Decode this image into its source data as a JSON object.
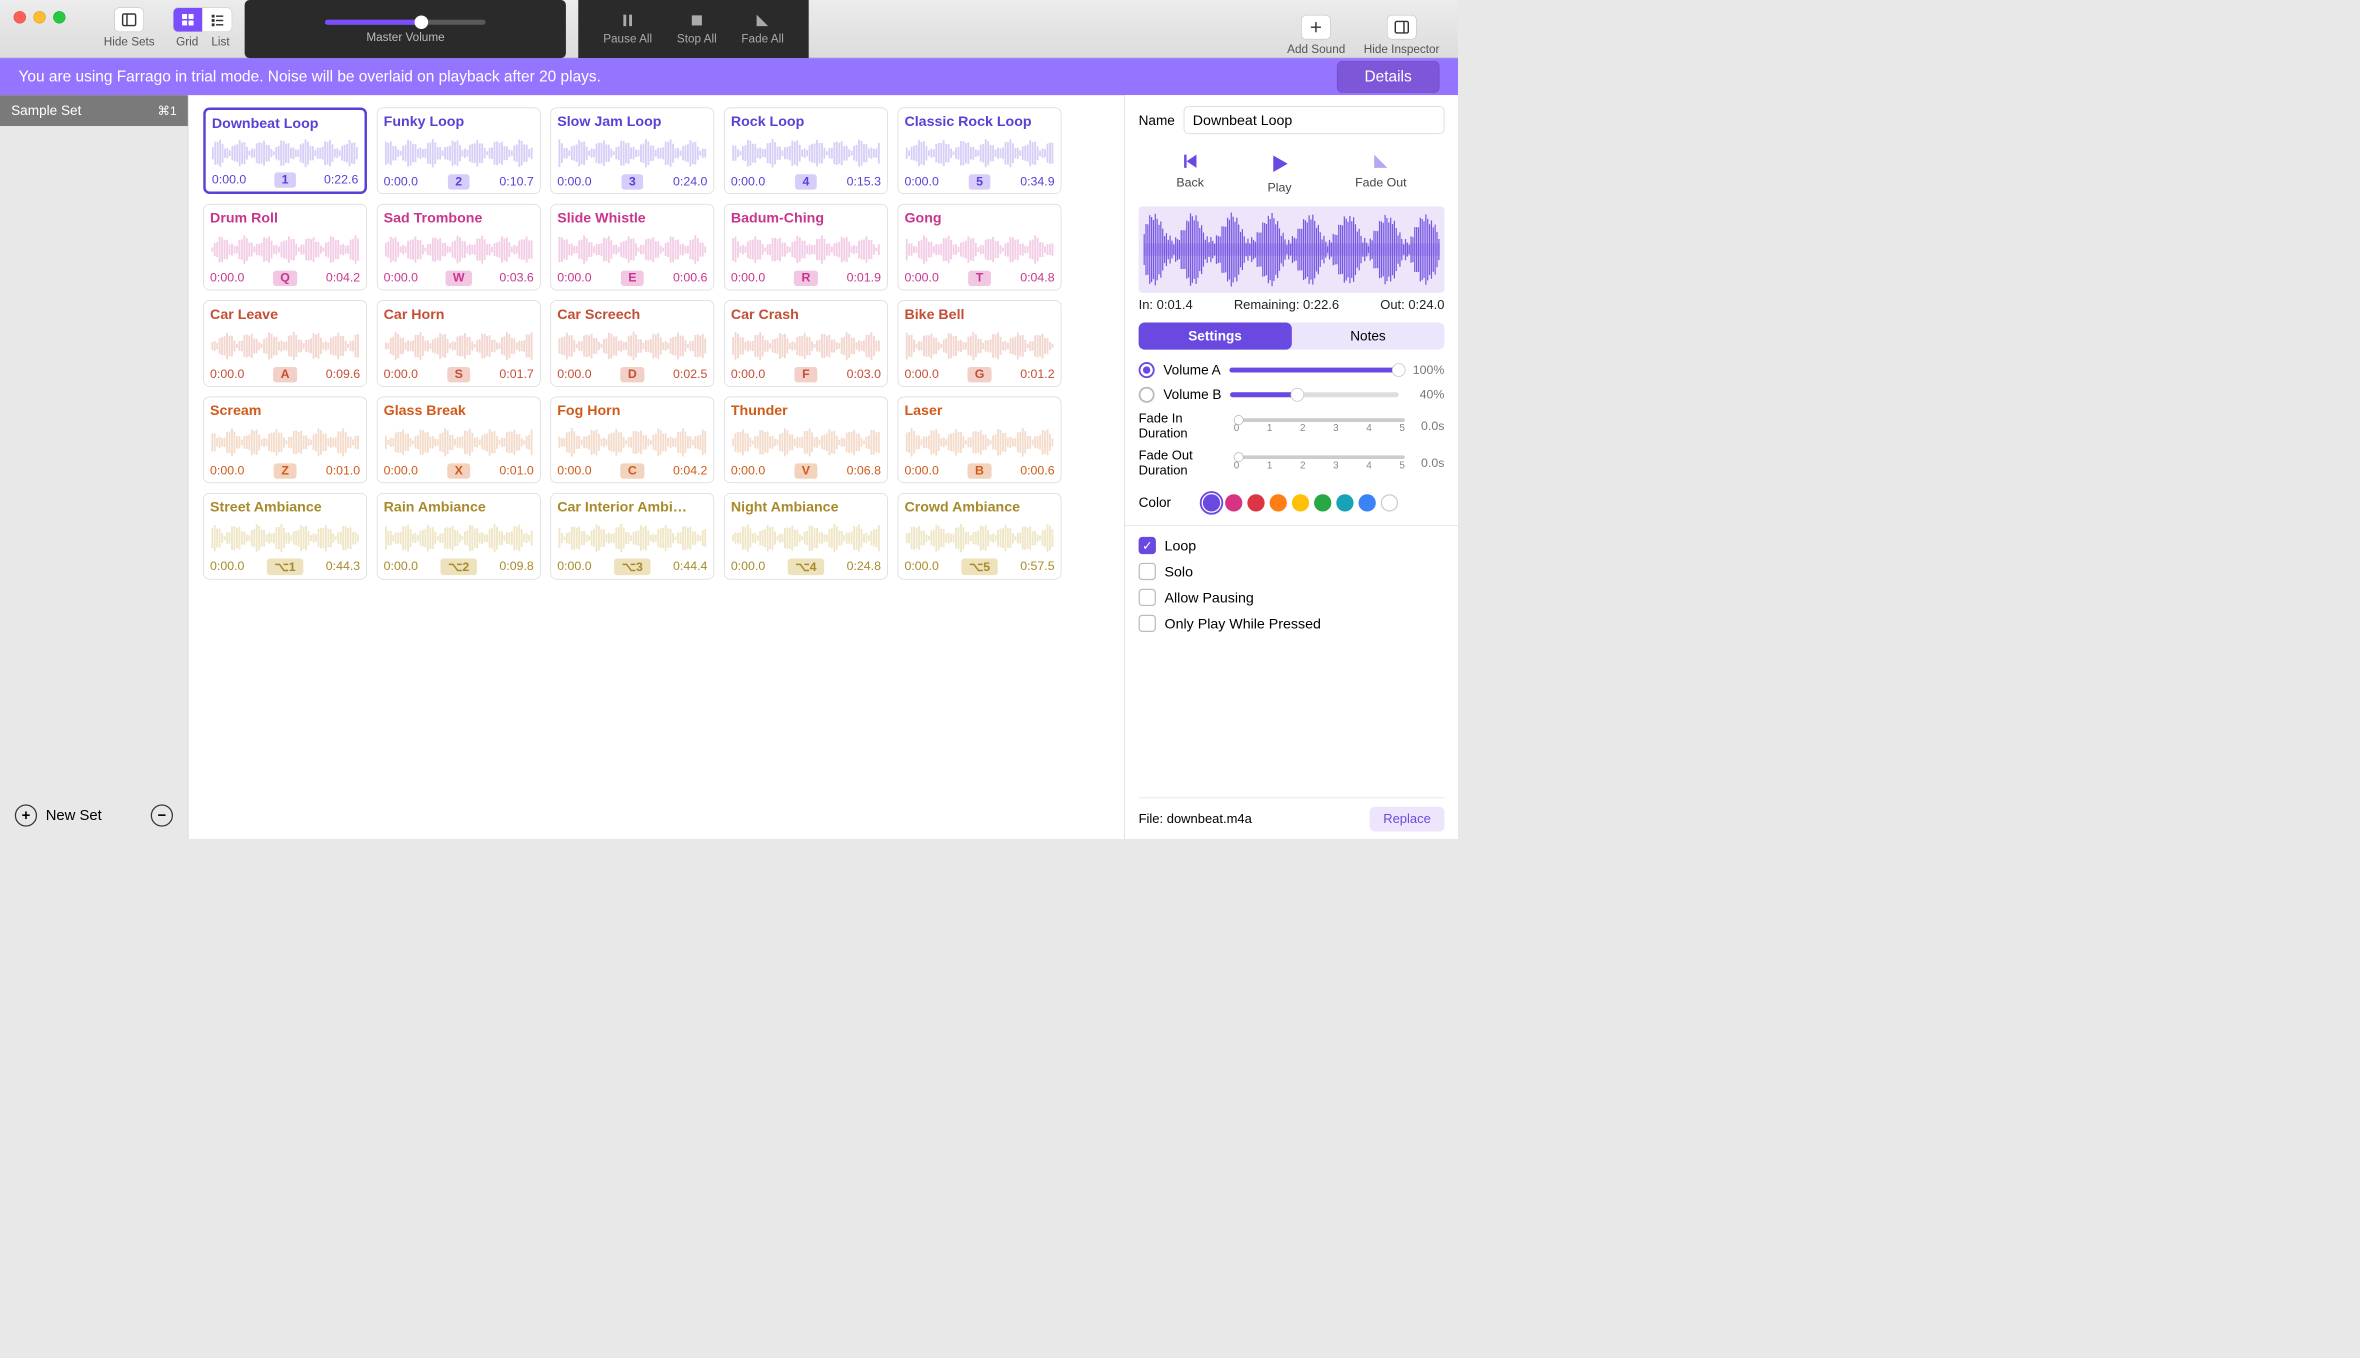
{
  "toolbar": {
    "hide_sets": "Hide Sets",
    "grid": "Grid",
    "list": "List",
    "master_volume": "Master Volume",
    "pause_all": "Pause All",
    "stop_all": "Stop All",
    "fade_all": "Fade All",
    "add_sound": "Add Sound",
    "hide_inspector": "Hide Inspector"
  },
  "banner": {
    "text": "You are using Farrago in trial mode. Noise will be overlaid on playback after 20 plays.",
    "button": "Details"
  },
  "sidebar": {
    "sets": [
      {
        "name": "Sample Set",
        "shortcut": "⌘1"
      }
    ],
    "new_set": "New Set"
  },
  "tiles": [
    {
      "title": "Downbeat Loop",
      "pos": "0:00.0",
      "key": "1",
      "dur": "0:22.6",
      "row": 0,
      "selected": true
    },
    {
      "title": "Funky Loop",
      "pos": "0:00.0",
      "key": "2",
      "dur": "0:10.7",
      "row": 0
    },
    {
      "title": "Slow Jam Loop",
      "pos": "0:00.0",
      "key": "3",
      "dur": "0:24.0",
      "row": 0
    },
    {
      "title": "Rock Loop",
      "pos": "0:00.0",
      "key": "4",
      "dur": "0:15.3",
      "row": 0
    },
    {
      "title": "Classic Rock Loop",
      "pos": "0:00.0",
      "key": "5",
      "dur": "0:34.9",
      "row": 0
    },
    {
      "title": "Drum Roll",
      "pos": "0:00.0",
      "key": "Q",
      "dur": "0:04.2",
      "row": 1
    },
    {
      "title": "Sad Trombone",
      "pos": "0:00.0",
      "key": "W",
      "dur": "0:03.6",
      "row": 1
    },
    {
      "title": "Slide Whistle",
      "pos": "0:00.0",
      "key": "E",
      "dur": "0:00.6",
      "row": 1
    },
    {
      "title": "Badum-Ching",
      "pos": "0:00.0",
      "key": "R",
      "dur": "0:01.9",
      "row": 1
    },
    {
      "title": "Gong",
      "pos": "0:00.0",
      "key": "T",
      "dur": "0:04.8",
      "row": 1
    },
    {
      "title": "Car Leave",
      "pos": "0:00.0",
      "key": "A",
      "dur": "0:09.6",
      "row": 2
    },
    {
      "title": "Car Horn",
      "pos": "0:00.0",
      "key": "S",
      "dur": "0:01.7",
      "row": 2
    },
    {
      "title": "Car Screech",
      "pos": "0:00.0",
      "key": "D",
      "dur": "0:02.5",
      "row": 2
    },
    {
      "title": "Car Crash",
      "pos": "0:00.0",
      "key": "F",
      "dur": "0:03.0",
      "row": 2
    },
    {
      "title": "Bike Bell",
      "pos": "0:00.0",
      "key": "G",
      "dur": "0:01.2",
      "row": 2
    },
    {
      "title": "Scream",
      "pos": "0:00.0",
      "key": "Z",
      "dur": "0:01.0",
      "row": 3
    },
    {
      "title": "Glass Break",
      "pos": "0:00.0",
      "key": "X",
      "dur": "0:01.0",
      "row": 3
    },
    {
      "title": "Fog Horn",
      "pos": "0:00.0",
      "key": "C",
      "dur": "0:04.2",
      "row": 3
    },
    {
      "title": "Thunder",
      "pos": "0:00.0",
      "key": "V",
      "dur": "0:06.8",
      "row": 3
    },
    {
      "title": "Laser",
      "pos": "0:00.0",
      "key": "B",
      "dur": "0:00.6",
      "row": 3
    },
    {
      "title": "Street Ambiance",
      "pos": "0:00.0",
      "key": "⌥1",
      "dur": "0:44.3",
      "row": 4
    },
    {
      "title": "Rain Ambiance",
      "pos": "0:00.0",
      "key": "⌥2",
      "dur": "0:09.8",
      "row": 4
    },
    {
      "title": "Car Interior Ambi…",
      "pos": "0:00.0",
      "key": "⌥3",
      "dur": "0:44.4",
      "row": 4
    },
    {
      "title": "Night Ambiance",
      "pos": "0:00.0",
      "key": "⌥4",
      "dur": "0:24.8",
      "row": 4
    },
    {
      "title": "Crowd Ambiance",
      "pos": "0:00.0",
      "key": "⌥5",
      "dur": "0:57.5",
      "row": 4
    }
  ],
  "inspector": {
    "name_label": "Name",
    "name_value": "Downbeat Loop",
    "back": "Back",
    "play": "Play",
    "fade_out": "Fade Out",
    "in_time": "In: 0:01.4",
    "remaining": "Remaining: 0:22.6",
    "out_time": "Out: 0:24.0",
    "tab_settings": "Settings",
    "tab_notes": "Notes",
    "volume_a_label": "Volume A",
    "volume_a_value": "100%",
    "volume_a_pct": 100,
    "volume_b_label": "Volume B",
    "volume_b_value": "40%",
    "volume_b_pct": 40,
    "fade_in_label": "Fade In Duration",
    "fade_in_value": "0.0s",
    "fade_out_label": "Fade Out Duration",
    "fade_out_value": "0.0s",
    "fade_ticks": [
      "0",
      "1",
      "2",
      "3",
      "4",
      "5"
    ],
    "color_label": "Color",
    "colors": [
      "#6a49e0",
      "#d63384",
      "#dc3545",
      "#fd7e14",
      "#ffc107",
      "#28a745",
      "#17a2b8",
      "#3b82f6",
      "#ffffff"
    ],
    "loop_label": "Loop",
    "solo_label": "Solo",
    "allow_pausing_label": "Allow Pausing",
    "only_pressed_label": "Only Play While Pressed",
    "file_label": "File:",
    "file_name": "downbeat.m4a",
    "replace": "Replace"
  }
}
